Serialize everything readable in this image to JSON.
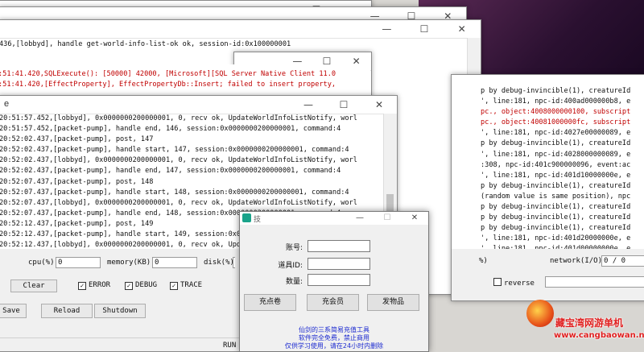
{
  "window_controls": {
    "minimize": "—",
    "maximize": "☐",
    "close": "✕"
  },
  "win1": {
    "lines": [
      "436,[lobbyd], handle get-world-info-list-ok ok, session-id:0x100000001"
    ]
  },
  "win2": {
    "lines": [
      ":51:41.420,SQLExecute(): [50000] 42000, [Microsoft][SQL Server Native Client 11.0",
      ":51:41.420,[EffectProperty], EffectPropertyDb::Insert; failed to insert property,"
    ]
  },
  "right_window": {
    "lines": [
      {
        "text": "p by debug-invincible(1), creatureId",
        "red": false
      },
      {
        "text": "', line:181, npc-id:400ad000000b8, e",
        "red": false
      },
      {
        "text": "pc., object:4008000000100, subscript",
        "red": true
      },
      {
        "text": "pc., object:40081000000fc, subscript",
        "red": true
      },
      {
        "text": "', line:181, npc-id:4027e00000089, e",
        "red": false
      },
      {
        "text": "p by debug-invincible(1), creatureId",
        "red": false
      },
      {
        "text": "', line:181, npc-id:4028000000089, e",
        "red": false
      },
      {
        "text": ":308, npc-id:401c900000096, event:ac",
        "red": false
      },
      {
        "text": "', line:181, npc-id:401d10000000e, e",
        "red": false
      },
      {
        "text": "p by debug-invincible(1), creatureId",
        "red": false
      },
      {
        "text": "(random value is same position), npc",
        "red": false
      },
      {
        "text": "p by debug-invincible(1), creatureId",
        "red": false
      },
      {
        "text": "p by debug-invincible(1), creatureId",
        "red": false
      },
      {
        "text": "p by debug-invincible(1), creatureId",
        "red": false
      },
      {
        "text": "', line:181, npc-id:401d20000000e, e",
        "red": false
      },
      {
        "text": "', line:181, npc-id:401d00000000e, e",
        "red": false
      }
    ],
    "network_label": "network(I/O)",
    "network_value": "0 / 0",
    "percent_label": "%)",
    "reverse_label": "reverse"
  },
  "front_window": {
    "title_char": "e",
    "lines": [
      "20:51:57.452,[lobbyd], 0x0000000200000001, 0, recv ok, UpdateWorldInfoListNotify, worl",
      "20:51:57.452,[packet-pump], handle end, 146, session:0x0000000200000001, command:4",
      "20:52:02.437,[packet-pump], post, 147",
      "20:52:02.437,[packet-pump], handle start, 147, session:0x0000000200000001, command:4",
      "20:52:02.437,[lobbyd], 0x0000000200000001, 0, recv ok, UpdateWorldInfoListNotify, worl",
      "20:52:02.437,[packet-pump], handle end, 147, session:0x0000000200000001, command:4",
      "20:52:07.437,[packet-pump], post, 148",
      "20:52:07.437,[packet-pump], handle start, 148, session:0x0000000200000001, command:4",
      "20:52:07.437,[lobbyd], 0x0000000200000001, 0, recv ok, UpdateWorldInfoListNotify, worl",
      "20:52:07.437,[packet-pump], handle end, 148, session:0x0000000200000001, command:4",
      "20:52:12.437,[packet-pump], post, 149",
      "20:52:12.437,[packet-pump], handle start, 149, session:0x0000000200000001, command:4",
      "20:52:12.437,[lobbyd], 0x0000000200000001, 0, recv ok, UpdateWorldInfoListNotify, worl",
      "20:52:12.437,[packet-pump], handle end, 149, session:0x0000000200000001, command:4"
    ]
  },
  "stats": {
    "cpu_label": "cpu(%)",
    "cpu_value": "0",
    "memory_label": "memory(KB)",
    "memory_value": "0",
    "disk_label": "disk(%)"
  },
  "controls": {
    "clear_label": "Clear",
    "error_label": "ERROR",
    "debug_label": "DEBUG",
    "trace_label": "TRACE",
    "save_label": "Save",
    "reload_label": "Reload",
    "shutdown_label": "Shutdown",
    "status_text": "RUN"
  },
  "dialog": {
    "title": "技",
    "account_label": "账号:",
    "item_id_label": "道具ID:",
    "quantity_label": "数量:",
    "recharge_coupon_label": "充点卷",
    "recharge_member_label": "充会员",
    "send_item_label": "发物品",
    "note_line1": "仙剑的三系简易充值工具",
    "note_line2": "软件完全免费，禁止商用",
    "note_line3": "仅供学习使用，请在24小时内删除"
  },
  "watermark": {
    "name": "藏宝湾网游单机",
    "url": "www.cangbaowan.net"
  },
  "colors": {
    "log_red": "#c00000",
    "note_blue": "#1c2ad0",
    "watermark_red": "#e02020"
  }
}
